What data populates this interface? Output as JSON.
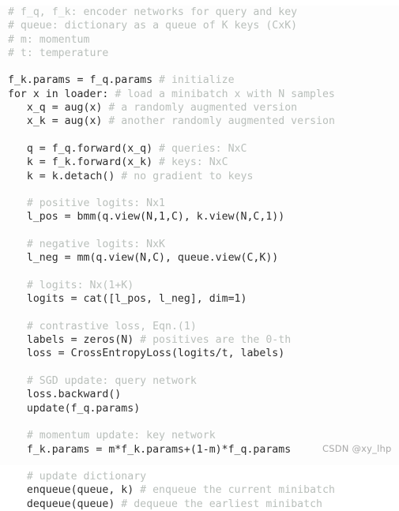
{
  "document": {
    "kind": "pseudocode-listing",
    "language": "python-pseudocode",
    "colors": {
      "background": "#fdfdfd",
      "code_text": "#2d2d2d",
      "comment_text": "#b9bfbb",
      "watermark_text": "#9a9a9a"
    }
  },
  "watermark": {
    "text": "CSDN @xy_lhp"
  },
  "lines": [
    {
      "code": "",
      "comment": "# f_q, f_k: encoder networks for query and key"
    },
    {
      "code": "",
      "comment": "# queue: dictionary as a queue of K keys (CxK)"
    },
    {
      "code": "",
      "comment": "# m: momentum"
    },
    {
      "code": "",
      "comment": "# t: temperature"
    },
    {
      "code": "",
      "comment": ""
    },
    {
      "code": "f_k.params = f_q.params ",
      "comment": "# initialize"
    },
    {
      "code": "for x in loader: ",
      "comment": "# load a minibatch x with N samples"
    },
    {
      "code": "   x_q = aug(x) ",
      "comment": "# a randomly augmented version"
    },
    {
      "code": "   x_k = aug(x) ",
      "comment": "# another randomly augmented version"
    },
    {
      "code": "",
      "comment": ""
    },
    {
      "code": "   q = f_q.forward(x_q) ",
      "comment": "# queries: NxC"
    },
    {
      "code": "   k = f_k.forward(x_k) ",
      "comment": "# keys: NxC"
    },
    {
      "code": "   k = k.detach() ",
      "comment": "# no gradient to keys"
    },
    {
      "code": "",
      "comment": ""
    },
    {
      "code": "   ",
      "comment": "# positive logits: Nx1"
    },
    {
      "code": "   l_pos = bmm(q.view(N,1,C), k.view(N,C,1))",
      "comment": ""
    },
    {
      "code": "",
      "comment": ""
    },
    {
      "code": "   ",
      "comment": "# negative logits: NxK"
    },
    {
      "code": "   l_neg = mm(q.view(N,C), queue.view(C,K))",
      "comment": ""
    },
    {
      "code": "",
      "comment": ""
    },
    {
      "code": "   ",
      "comment": "# logits: Nx(1+K)"
    },
    {
      "code": "   logits = cat([l_pos, l_neg], dim=1)",
      "comment": ""
    },
    {
      "code": "",
      "comment": ""
    },
    {
      "code": "   ",
      "comment": "# contrastive loss, Eqn.(1)"
    },
    {
      "code": "   labels = zeros(N) ",
      "comment": "# positives are the 0-th"
    },
    {
      "code": "   loss = CrossEntropyLoss(logits/t, labels)",
      "comment": ""
    },
    {
      "code": "",
      "comment": ""
    },
    {
      "code": "   ",
      "comment": "# SGD update: query network"
    },
    {
      "code": "   loss.backward()",
      "comment": ""
    },
    {
      "code": "   update(f_q.params)",
      "comment": ""
    },
    {
      "code": "",
      "comment": ""
    },
    {
      "code": "   ",
      "comment": "# momentum update: key network"
    },
    {
      "code": "   f_k.params = m*f_k.params+(1-m)*f_q.params",
      "comment": ""
    },
    {
      "code": "",
      "comment": ""
    },
    {
      "code": "   ",
      "comment": "# update dictionary"
    },
    {
      "code": "   enqueue(queue, k) ",
      "comment": "# enqueue the current minibatch"
    },
    {
      "code": "   dequeue(queue) ",
      "comment": "# dequeue the earliest minibatch"
    }
  ]
}
